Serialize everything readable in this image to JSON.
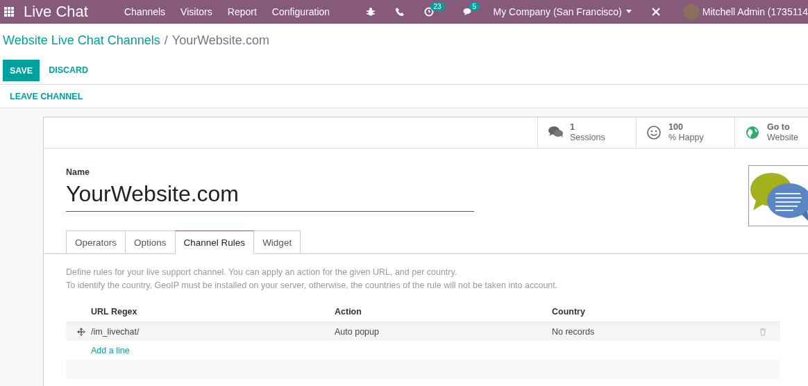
{
  "navbar": {
    "app_title": "Live Chat",
    "menu": [
      "Channels",
      "Visitors",
      "Report",
      "Configuration"
    ],
    "activity_count": "23",
    "message_count": "5",
    "company": "My Company (San Francisco)",
    "user": "Mitchell Admin (1735114"
  },
  "breadcrumb": {
    "parent": "Website Live Chat Channels",
    "separator": "/",
    "current": "YourWebsite.com"
  },
  "buttons": {
    "save": "SAVE",
    "discard": "DISCARD"
  },
  "action": "LEAVE CHANNEL",
  "stat_buttons": [
    {
      "kind": "sessions",
      "value": "1",
      "label": "Sessions"
    },
    {
      "kind": "happy",
      "value": "100",
      "label": "% Happy"
    },
    {
      "kind": "website",
      "value": "Go to",
      "label": "Website"
    }
  ],
  "name_label": "Name",
  "name": "YourWebsite.com",
  "tabs": [
    {
      "label": "Operators",
      "selected": false
    },
    {
      "label": "Options",
      "selected": false
    },
    {
      "label": "Channel Rules",
      "selected": true
    },
    {
      "label": "Widget",
      "selected": false
    }
  ],
  "help": [
    "Define rules for your live support channel. You can apply an action for the given URL, and per country.",
    "To identify the country, GeoIP must be installed on your server, otherwise, the countries of the rule will not be taken into account."
  ],
  "table": {
    "columns": [
      "URL Regex",
      "Action",
      "Country"
    ],
    "rows": [
      [
        "/im_livechat/",
        "Auto popup",
        "No records"
      ]
    ],
    "add_line": "Add a line"
  }
}
